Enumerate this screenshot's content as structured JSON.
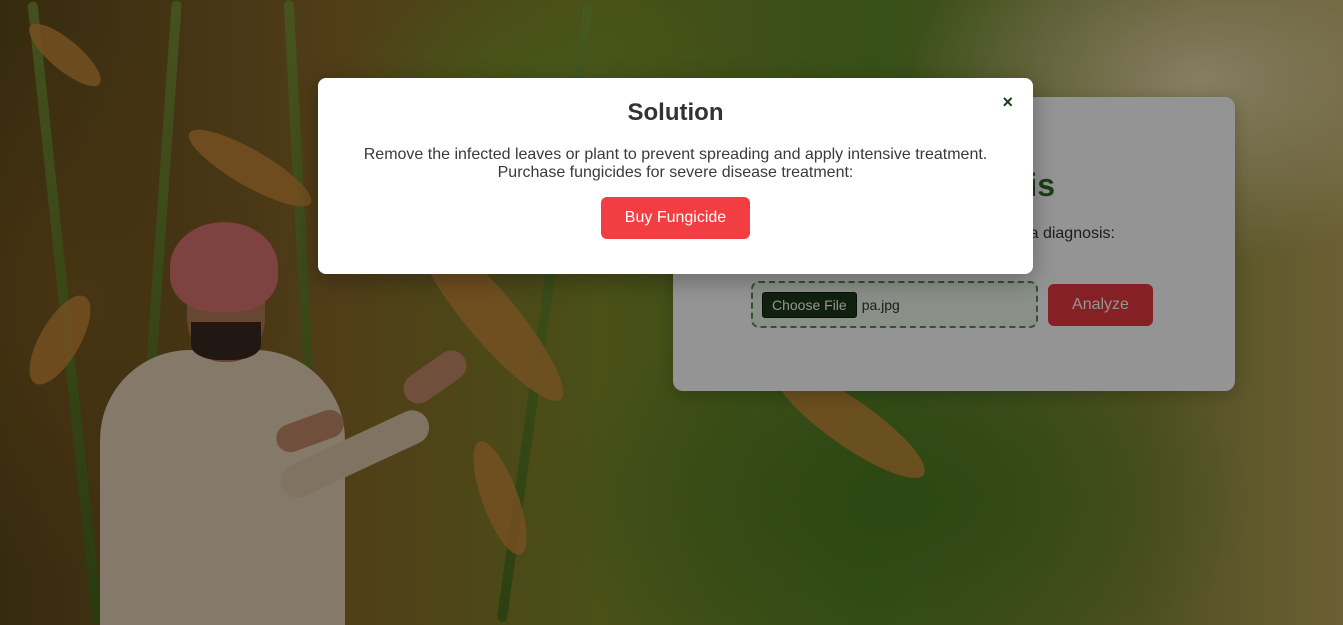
{
  "background": {
    "scene": "rice-field-with-farmer"
  },
  "card": {
    "title": "Diagnosis",
    "subtitle": "a diagnosis:",
    "file_button_label": "Choose File",
    "file_name": "pa.jpg",
    "analyze_label": "Analyze"
  },
  "modal": {
    "title": "Solution",
    "close_icon": "×",
    "line1": "Remove the infected leaves or plant to prevent spreading and apply intensive treatment.",
    "line2": "Purchase fungicides for severe disease treatment:",
    "buy_label": "Buy Fungicide"
  },
  "colors": {
    "accent_green": "#2e6b27",
    "button_red": "#f23e43",
    "analyze_red": "#e5393f"
  }
}
